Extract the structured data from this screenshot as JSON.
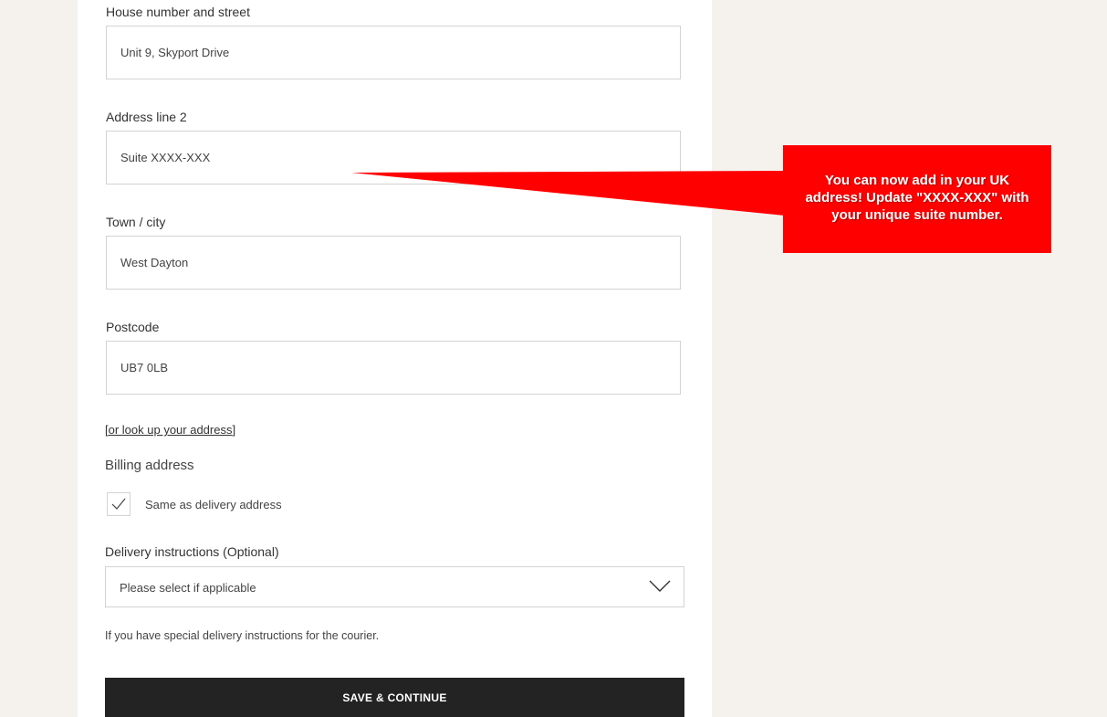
{
  "form": {
    "fields": [
      {
        "label": "House number and street",
        "value": "Unit 9, Skyport Drive"
      },
      {
        "label": "Address line 2",
        "value": "Suite XXXX-XXX"
      },
      {
        "label": "Town / city",
        "value": "West Dayton"
      },
      {
        "label": "Postcode",
        "value": "UB7 0LB"
      }
    ],
    "lookup_link": "[or look up your address]",
    "billing": {
      "title": "Billing address",
      "same_as_delivery_label": "Same as delivery address",
      "same_as_delivery_checked": true
    },
    "delivery_instructions": {
      "label": "Delivery instructions (Optional)",
      "selected": "Please select if applicable",
      "helper": "If you have special delivery instructions for the courier."
    },
    "submit_label": "SAVE & CONTINUE"
  },
  "callout": {
    "lines": [
      "You can now add in your UK",
      "address! Update \"XXXX-XXX\" with",
      "your unique suite number."
    ],
    "color": "#ff0000"
  }
}
